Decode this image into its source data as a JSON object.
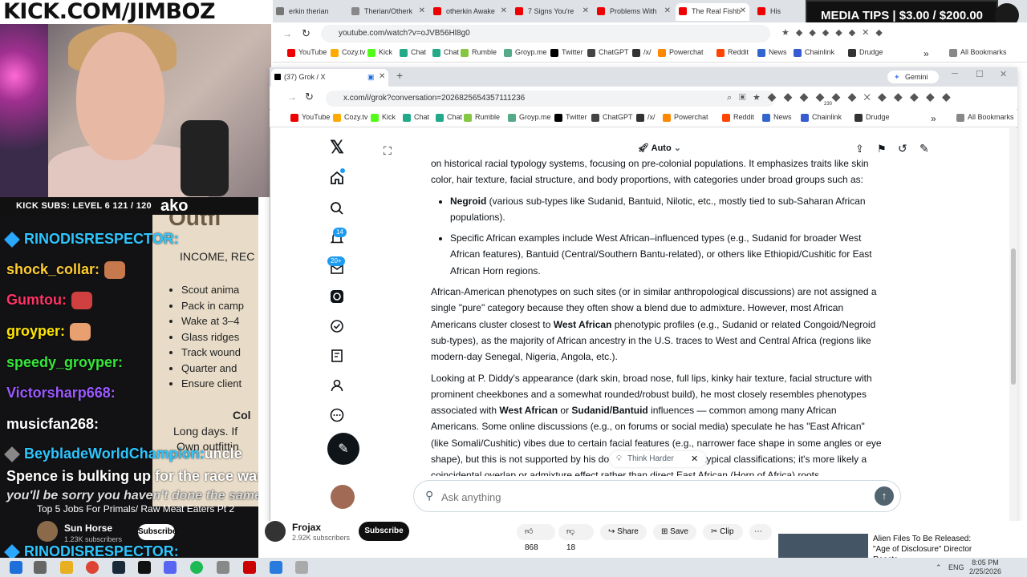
{
  "overlay": {
    "banner": "KICK.COM/JIMBOZ",
    "subs_bar": "KICK SUBS: LEVEL 6 121 / 120",
    "media_tips": "MEDIA TIPS | $3.00 / $200.00",
    "chat_panel": {
      "title": "Outfi",
      "subtitle": "INCOME, REC",
      "items": [
        "Scout anima",
        "Pack in camp",
        "Wake at 3–4",
        "Glass ridges",
        "Track wound",
        "Quarter and",
        "Ensure client"
      ],
      "line1": "Col",
      "line2": "Long days. If",
      "line3": "Own outfittin"
    },
    "chat": [
      {
        "user": "RINODISRESPECTOR:",
        "color": "#2ec6ff"
      },
      {
        "user": "shock_collar:",
        "color": "#ffcc33"
      },
      {
        "user": "Gumtou:",
        "color": "#ff3366"
      },
      {
        "user": "groyper:",
        "color": "#ffe600"
      },
      {
        "user": "speedy_groyper:",
        "color": "#35e83a"
      },
      {
        "user": "Victorsharp668:",
        "color": "#9b59ff"
      },
      {
        "user": "musicfan268:",
        "color": "#ffffff"
      },
      {
        "user": "BeybladeWorldChampion:",
        "color": "#2ec6ff"
      }
    ],
    "chat_msg_user_tail": "uncle",
    "chat_msg": "Spence is bulking up for the race war",
    "chat_msg2": "you'll be sorry you haven't done the same",
    "yt_title": "Top 5 Jobs For Primals/ Raw Meat Eaters Pt 2",
    "yt_channel": "Sun Horse",
    "yt_subs": "1.23K subscribers",
    "yt_subscribe": "Subscribe",
    "chat_last": "RINODISRESPECTOR:"
  },
  "browser1": {
    "tabs": [
      "erkin therian",
      "Therian/Otherk",
      "otherkin Awake",
      "7 Signs You're",
      "Problems With",
      "The Real Fishb",
      "His"
    ],
    "url": "youtube.com/watch?v=oJVB56Hl8g0",
    "bookmarks": [
      "YouTube",
      "Cozy.tv",
      "Kick",
      "Chat",
      "Chat",
      "Rumble",
      "Groyp.me",
      "Twitter",
      "ChatGPT",
      "/x/",
      "Powerchat",
      "Reddit",
      "News",
      "Chainlink",
      "Drudge"
    ],
    "all_bookmarks": "All Bookmarks",
    "bm_more": "»"
  },
  "browser2": {
    "tab_title": "(37) Grok / X",
    "gemini": "Gemini",
    "url": "x.com/i/grok?conversation=2026825654357111236",
    "bookmarks": [
      "YouTube",
      "Cozy.tv",
      "Kick",
      "Chat",
      "Chat",
      "Rumble",
      "Groyp.me",
      "Twitter",
      "ChatGPT",
      "/x/",
      "Powerchat",
      "Reddit",
      "News",
      "Chainlink",
      "Drudge"
    ],
    "all_bookmarks": "All Bookmarks",
    "ext_badge": "230",
    "bm_more": "»"
  },
  "x": {
    "notif_count": "14",
    "msg_count": "20+",
    "model": "Auto",
    "think_harder": "Think Harder",
    "ask_placeholder": "Ask anything",
    "content": {
      "p0": "on historical racial typology systems, focusing on pre-colonial populations. It emphasizes traits like skin color, hair texture, facial structure, and body proportions, with categories under broad groups such as:",
      "li1_bold": "Negroid",
      "li1_rest": " (various sub-types like Sudanid, Bantuid, Nilotic, etc., mostly tied to sub-Saharan African populations).",
      "li2": "Specific African examples include West African–influenced types (e.g., Sudanid for broader West African features), Bantuid (Central/Southern Bantu-related), or others like Ethiopid/Cushitic for East African Horn regions.",
      "p1a": "African-American phenotypes on such sites (or in similar anthropological discussions) are not assigned a single \"pure\" category because they often show a blend due to admixture. However, most African Americans cluster closest to ",
      "p1b": "West African",
      "p1c": " phenotypic profiles (e.g., Sudanid or related Congoid/Negroid sub-types), as the majority of African ancestry in the U.S. traces to West and Central Africa (regions like modern-day Senegal, Nigeria, Angola, etc.).",
      "p2a": "Looking at P. Diddy's appearance (dark skin, broad nose, full lips, kinky hair texture, facial structure with prominent cheekbones and a somewhat rounded/robust build), he most closely resembles phenotypes associated with ",
      "p2b": "West African",
      "p2c": " or ",
      "p2d": "Sudanid/Bantuid",
      "p2e": " influences — common among many African Americans. Some online discussions (e.g., on forums or social media) speculate he has \"East African\" (like Somali/Cushitic) vibes due to certain facial features (e.g., narrower face shape in some angles or eye shape), but this is not supported by his do",
      "p2f": "typical classifications; it's more likely a coincidental overlap or admixture effect rather than direct East African (Horn of Africa) roots."
    }
  },
  "youtube": {
    "channel": "Frojax",
    "subs": "2.92K subscribers",
    "subscribe": "Subscribe",
    "likes": "868",
    "dislikes": "18",
    "share": "Share",
    "save": "Save",
    "clip": "Clip",
    "rec_title": "Alien Files To Be Released: \"Age of Disclosure\" Director Reacts"
  },
  "taskbar": {
    "lang": "ENG",
    "time": "8:05 PM",
    "date": "2/25/2026"
  }
}
